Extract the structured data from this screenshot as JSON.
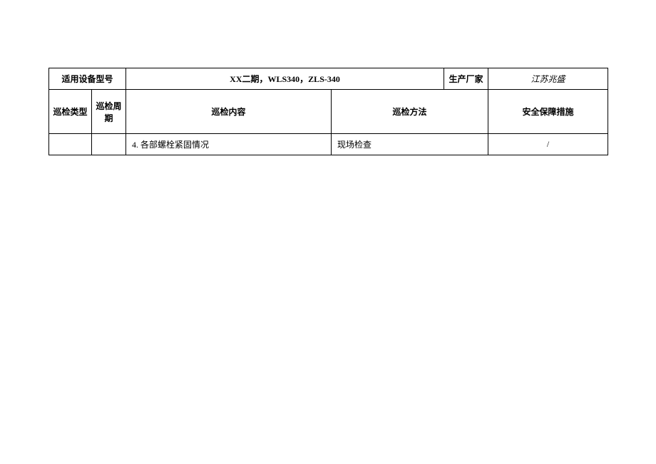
{
  "header": {
    "equip_model_label": "适用设备型号",
    "equip_model_value": "XX二期，WLS340，ZLS-340",
    "manufacturer_label": "生产厂家",
    "manufacturer_value": "江苏兆盛"
  },
  "columns": {
    "type": "巡检类型",
    "period": "巡检周期",
    "content": "巡检内容",
    "method": "巡检方法",
    "safety": "安全保障措施"
  },
  "row": {
    "type": "",
    "period": "",
    "content": "4. 各部螺栓紧固情况",
    "method": "现场检查",
    "safety": "/"
  }
}
